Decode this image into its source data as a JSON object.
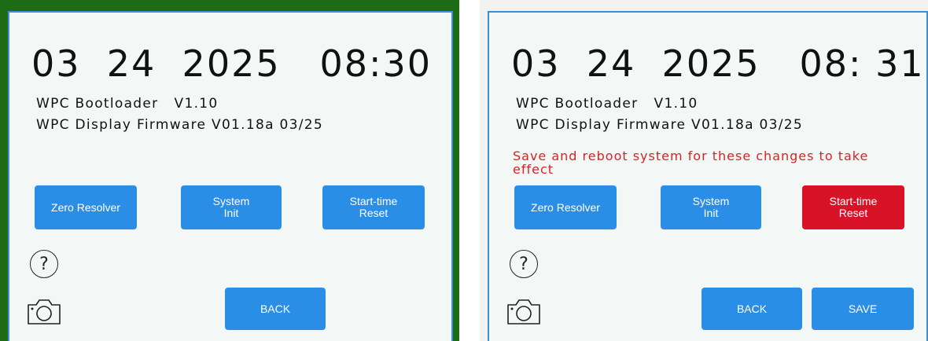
{
  "screens": [
    {
      "datetime": "03  24  2025   08:30",
      "bootloader": "WPC Bootloader   V1.10",
      "firmware": "WPC Display Firmware V01.18a 03/25",
      "warning": "",
      "buttons": {
        "zero_resolver": "Zero Resolver",
        "system_init_line1": "System",
        "system_init_line2": "Init",
        "start_time_reset_line1": "Start-time",
        "start_time_reset_line2": "Reset",
        "back": "BACK"
      },
      "help_icon_text": "?",
      "start_time_reset_color": "#2b8ee6"
    },
    {
      "datetime": "03  24  2025   08: 31",
      "bootloader": "WPC Bootloader   V1.10",
      "firmware": "WPC Display Firmware V01.18a 03/25",
      "warning": "Save and reboot system for these changes to take effect",
      "buttons": {
        "zero_resolver": "Zero Resolver",
        "system_init_line1": "System",
        "system_init_line2": "Init",
        "start_time_reset_line1": "Start-time",
        "start_time_reset_line2": "Reset",
        "back": "BACK",
        "save": "SAVE"
      },
      "help_icon_text": "?",
      "start_time_reset_color": "#d81327"
    }
  ],
  "colors": {
    "left_frame": "#1e6b15",
    "screen_bg": "#f3f7f5",
    "button_blue": "#2b8ee6",
    "button_red": "#d81327",
    "warning_text": "#d92226"
  },
  "icons": [
    "help-icon",
    "camera-icon"
  ]
}
